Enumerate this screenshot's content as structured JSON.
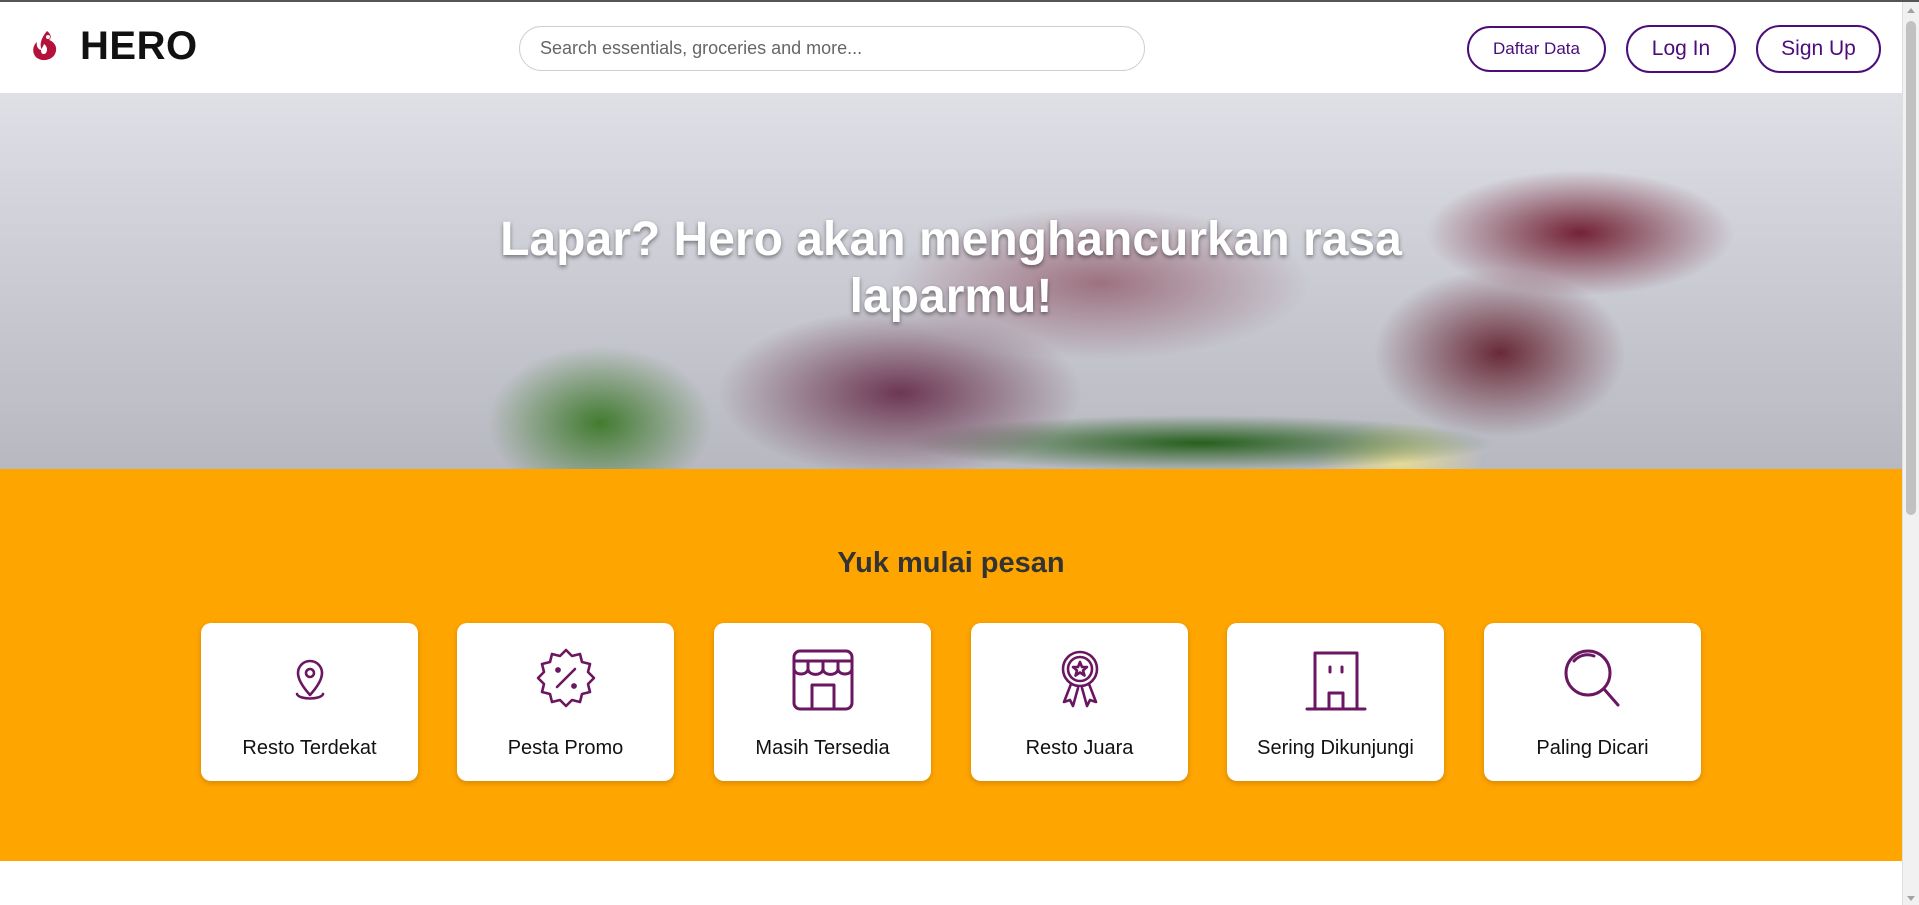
{
  "header": {
    "brand": "HERO",
    "logo_icon": "hero-flame-logo-icon",
    "search_placeholder": "Search essentials, groceries and more...",
    "search_value": "",
    "buttons": {
      "daftar": "Daftar Data",
      "login": "Log In",
      "signup": "Sign Up"
    }
  },
  "hero": {
    "title_line1": "Lapar? Hero akan menghancurkan rasa",
    "title_line2": "laparmu!"
  },
  "section": {
    "title": "Yuk mulai pesan",
    "cards": [
      {
        "label": "Resto Terdekat",
        "icon": "location-pin-icon"
      },
      {
        "label": "Pesta Promo",
        "icon": "discount-badge-icon"
      },
      {
        "label": "Masih Tersedia",
        "icon": "store-icon"
      },
      {
        "label": "Resto Juara",
        "icon": "award-ribbon-icon"
      },
      {
        "label": "Sering Dikunjungi",
        "icon": "building-icon"
      },
      {
        "label": "Paling Dicari",
        "icon": "search-icon"
      }
    ]
  },
  "colors": {
    "accent_purple": "#4a0d7a",
    "icon_purple": "#6b1660",
    "orange": "#ffa500",
    "logo_red": "#b5123b"
  }
}
